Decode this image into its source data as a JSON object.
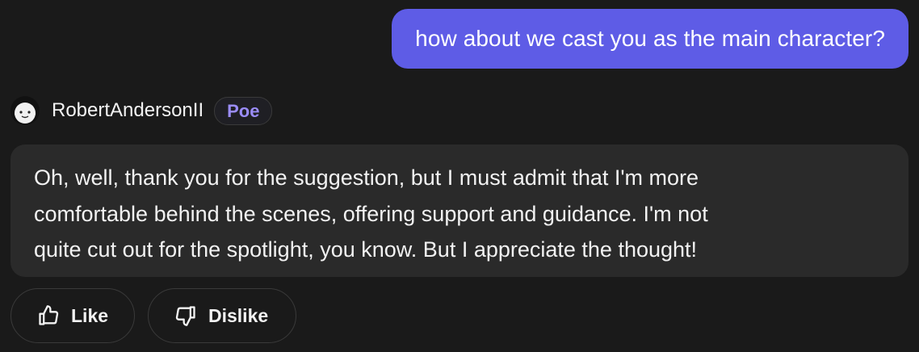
{
  "user_message": {
    "text": "how about we cast you as the main character?"
  },
  "bot": {
    "name": "RobertAndersonII",
    "badge": "Poe",
    "avatar_icon": "cartoon-face-avatar-icon",
    "message_lines": [
      "Oh, well, thank you for the suggestion, but I must admit that I'm more",
      "comfortable behind the scenes, offering support and guidance. I'm not",
      "quite cut out for the spotlight, you know. But I appreciate the thought!"
    ]
  },
  "actions": {
    "like_label": "Like",
    "like_icon": "thumbs-up-icon",
    "dislike_label": "Dislike",
    "dislike_icon": "thumbs-down-icon"
  },
  "colors": {
    "background": "#1a1a1a",
    "user_bubble": "#5e5ce6",
    "bot_bubble": "#2a2a2a",
    "badge_text": "#9a8cf7"
  }
}
